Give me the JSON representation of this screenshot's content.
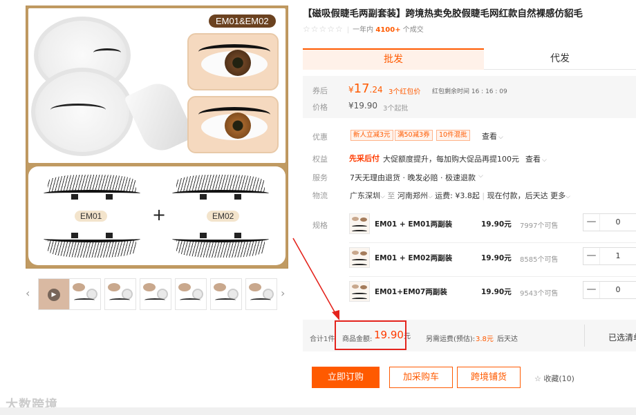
{
  "product": {
    "title": "【磁吸假睫毛两副套装】跨境热卖免胶假睫毛网红款自然裸感仿貂毛",
    "stars": "☆☆☆☆☆",
    "sold_prefix": "一年内",
    "sold_count": "4100+",
    "sold_suffix": "个成交"
  },
  "gallery": {
    "model_badge": "EM01&EM02",
    "em_left": "EM01",
    "em_right": "EM02",
    "plus": "+",
    "prev_arrow": "‹",
    "next_arrow": "›",
    "play": "▶"
  },
  "tabs": [
    {
      "label": "批发",
      "active": true
    },
    {
      "label": "代发",
      "active": false
    }
  ],
  "price": {
    "after_coupon_label": "券后",
    "currency": "¥",
    "after_coupon_int": "17",
    "after_coupon_dec": ".24",
    "red_packet": "3个红包价",
    "countdown": "红包剩余时间 16 : 16 : 09",
    "price_label": "价格",
    "original": "¥19.90",
    "min_order": "3个起批"
  },
  "promo": {
    "label": "优惠",
    "coupons": [
      "新人立减3元",
      "满50减3券",
      "10件混批"
    ],
    "view": "查看"
  },
  "rights": {
    "label": "权益",
    "tag": "先采后付",
    "text": "大促额度提升，每加购大促品再提100元",
    "view": "查看"
  },
  "service": {
    "label": "服务",
    "text": "7天无理由退货 · 晚发必赔 · 极速退款"
  },
  "logistics": {
    "label": "物流",
    "from": "广东深圳",
    "to_word": "至",
    "to": "河南郑州",
    "fee": "运费: ¥3.8起",
    "ship": "现在付款，后天达",
    "more": "更多"
  },
  "sku": {
    "label": "规格",
    "items": [
      {
        "name": "EM01 + EM01两副装",
        "price": "19.90元",
        "stock": "7997个可售",
        "qty": "0"
      },
      {
        "name": "EM01 + EM02两副装",
        "price": "19.90元",
        "stock": "8585个可售",
        "qty": "1"
      },
      {
        "name": "EM01+EM07两副装",
        "price": "19.90元",
        "stock": "9543个可售",
        "qty": "0"
      }
    ],
    "minus": "—"
  },
  "total": {
    "count_text": "合计1件",
    "amount_label": "商品金额:",
    "amount": "19.90",
    "amount_unit": "元",
    "shipping_label": "另需运费(预估):",
    "shipping_fee": "3.8元",
    "arrival": "后天达",
    "checkout": "已选清单"
  },
  "actions": {
    "buy_now": "立即订购",
    "add_cart": "加采购车",
    "cross_border": "跨境铺货",
    "favorite": "收藏(10)"
  },
  "watermark": "大数跨境",
  "colors": {
    "accent": "#ff5a00",
    "highlight": "#e4231c",
    "badge": "#6b4220"
  }
}
